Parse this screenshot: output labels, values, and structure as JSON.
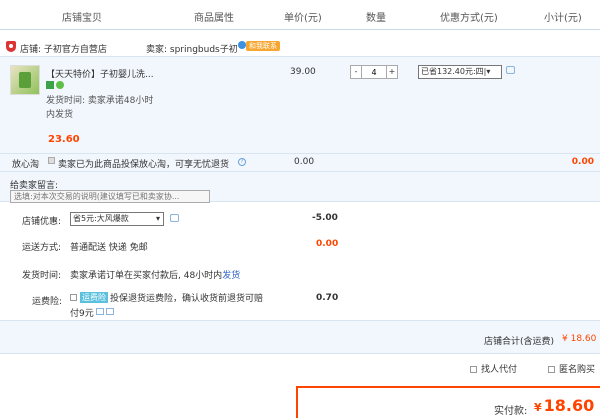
{
  "header": {
    "cols": [
      "店铺宝贝",
      "商品属性",
      "单价(元)",
      "数量",
      "优惠方式(元)",
      "小计(元)"
    ]
  },
  "shop": {
    "label": "店铺: 子初官方自营店",
    "seller": "卖家: springbuds子初",
    "talk_badge": "和我联系"
  },
  "item": {
    "title": "【天天特价】子初婴儿洗...",
    "ship_time": "发货时间: 卖家承诺48小时内发货",
    "price": "23.60",
    "unit_price": "39.00",
    "qty_minus": "-",
    "qty_value": "4",
    "qty_plus": "+",
    "promo": "已省132.40元:四|▾"
  },
  "insurance": {
    "label": "放心淘",
    "text": "卖家已为此商品投保放心淘，可享无忧退货",
    "help": "?",
    "price": "0.00",
    "total": "0.00"
  },
  "message": {
    "label": "给卖家留言:",
    "placeholder": "选填:对本次交易的说明(建议填写已和卖家协..."
  },
  "shop_discount": {
    "label": "店铺优惠:",
    "selected": "省5元:大风爆款",
    "value": "-5.00"
  },
  "delivery": {
    "label": "运送方式:",
    "text": "普通配送 快递 免邮",
    "value": "0.00"
  },
  "ship_time_row": {
    "label": "发货时间:",
    "text": "卖家承诺订单在买家付款后, 48小时内",
    "link": "发货"
  },
  "freight_insurance": {
    "label": "运费险:",
    "badge": "运费险",
    "text": "投保退货运费险，确认收货前退货可赔",
    "text2": "付9元",
    "value": "0.70"
  },
  "subtotal": {
    "label": "店铺合计(含运费)",
    "value": "¥ 18.60"
  },
  "options": {
    "proxy_pay": "找人代付",
    "anonymous": "匿名购买"
  },
  "pay": {
    "label": "实付款:",
    "symbol": "¥",
    "value": "18.60"
  },
  "colors": {
    "accent": "#ff4400",
    "row_bg": "#f2f7fd",
    "border": "#d8e4f0"
  }
}
